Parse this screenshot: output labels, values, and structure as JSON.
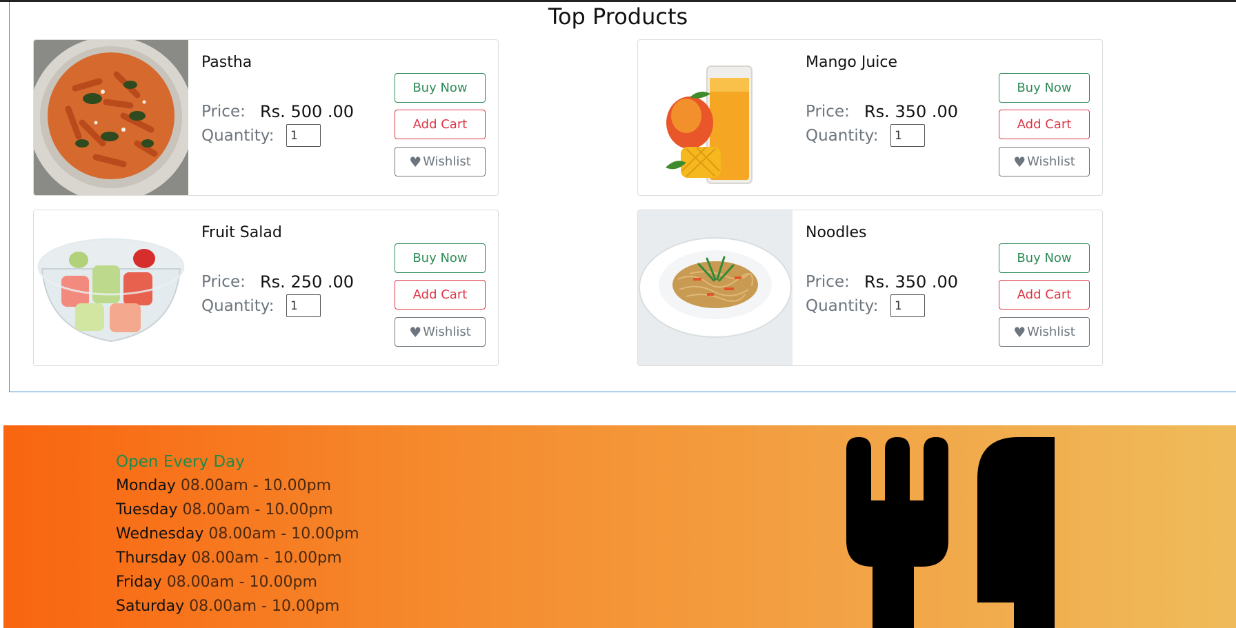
{
  "section": {
    "title": "Top Products"
  },
  "labels": {
    "price": "Price:",
    "quantity": "Quantity:"
  },
  "buttons": {
    "buy": "Buy Now",
    "cart": "Add Cart",
    "wishlist": "Wishlist"
  },
  "products": [
    {
      "name": "Pastha",
      "price": "Rs. 500 .00",
      "quantity": "1",
      "image": "pasta-image"
    },
    {
      "name": "Mango Juice",
      "price": "Rs. 350 .00",
      "quantity": "1",
      "image": "mango-juice-image"
    },
    {
      "name": "Fruit Salad",
      "price": "Rs. 250 .00",
      "quantity": "1",
      "image": "fruit-salad-image"
    },
    {
      "name": "Noodles",
      "price": "Rs. 350 .00",
      "quantity": "1",
      "image": "noodles-image"
    }
  ],
  "hours": {
    "title": "Open Every Day",
    "days": [
      {
        "day": "Monday",
        "time": "08.00am - 10.00pm"
      },
      {
        "day": "Tuesday",
        "time": "08.00am - 10.00pm"
      },
      {
        "day": "Wednesday",
        "time": "08.00am - 10.00pm"
      },
      {
        "day": "Thursday",
        "time": "08.00am - 10.00pm"
      },
      {
        "day": "Friday",
        "time": "08.00am - 10.00pm"
      },
      {
        "day": "Saturday",
        "time": "08.00am - 10.00pm"
      }
    ]
  },
  "colors": {
    "accent_green": "#2e8b57",
    "accent_red": "#dc3545",
    "footer_start": "#f96510",
    "footer_end": "#efbb5a"
  },
  "icons": {
    "wishlist": "heart-icon",
    "footer": "fork-knife-icon"
  }
}
